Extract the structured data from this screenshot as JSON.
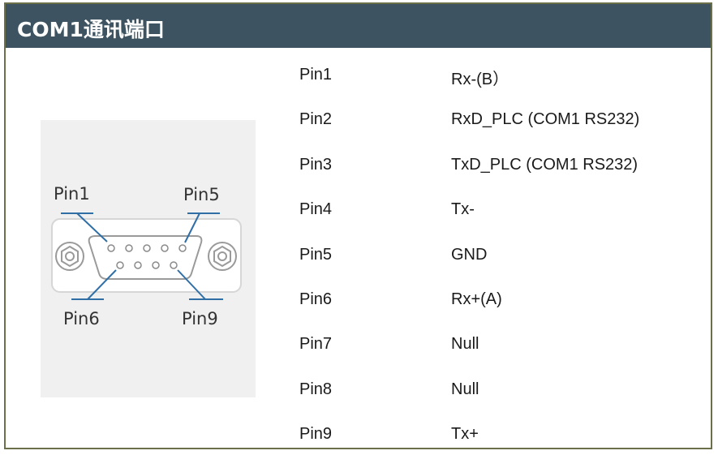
{
  "header": {
    "title": "COM1通讯端口"
  },
  "diagram": {
    "labels": {
      "pin1": "Pin1",
      "pin5": "Pin5",
      "pin6": "Pin6",
      "pin9": "Pin9"
    }
  },
  "pins": [
    {
      "pin": "Pin1",
      "function": "Rx-(B）"
    },
    {
      "pin": "Pin2",
      "function": "RxD_PLC (COM1 RS232)"
    },
    {
      "pin": "Pin3",
      "function": "TxD_PLC (COM1 RS232)"
    },
    {
      "pin": "Pin4",
      "function": "Tx-"
    },
    {
      "pin": "Pin5",
      "function": "GND"
    },
    {
      "pin": "Pin6",
      "function": "Rx+(A)"
    },
    {
      "pin": "Pin7",
      "function": "Null"
    },
    {
      "pin": "Pin8",
      "function": "Null"
    },
    {
      "pin": "Pin9",
      "function": "Tx+"
    }
  ]
}
